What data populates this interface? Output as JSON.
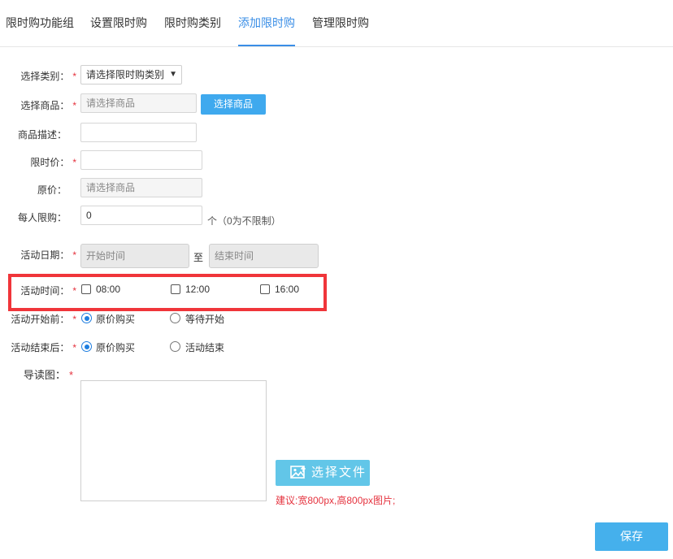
{
  "tabs": [
    {
      "label": "限时购功能组"
    },
    {
      "label": "设置限时购"
    },
    {
      "label": "限时购类别"
    },
    {
      "label": "添加限时购",
      "active": true
    },
    {
      "label": "管理限时购"
    }
  ],
  "form": {
    "category": {
      "label": "选择类别：",
      "required": "*",
      "value": "请选择限时购类别"
    },
    "product": {
      "label": "选择商品：",
      "required": "*",
      "placeholder": "请选择商品",
      "button": "选择商品"
    },
    "description": {
      "label": "商品描述：",
      "value": ""
    },
    "flash_price": {
      "label": "限时价：",
      "required": "*",
      "value": ""
    },
    "original_price": {
      "label": "原价：",
      "placeholder": "请选择商品"
    },
    "limit_per_person": {
      "label": "每人限购：",
      "value": "0",
      "note": "个（0为不限制）"
    },
    "activity_date": {
      "label": "活动日期：",
      "required": "*",
      "start_placeholder": "开始时间",
      "to": "至",
      "end_placeholder": "结束时间"
    },
    "activity_time": {
      "label": "活动时间：",
      "required": "*",
      "options": [
        {
          "label": "08:00",
          "checked": false
        },
        {
          "label": "12:00",
          "checked": false
        },
        {
          "label": "16:00",
          "checked": false
        }
      ]
    },
    "before_start": {
      "label": "活动开始前：",
      "required": "*",
      "options": [
        {
          "label": "原价购买",
          "selected": true
        },
        {
          "label": "等待开始",
          "selected": false
        }
      ]
    },
    "after_end": {
      "label": "活动结束后：",
      "required": "*",
      "options": [
        {
          "label": "原价购买",
          "selected": true
        },
        {
          "label": "活动结束",
          "selected": false
        }
      ]
    },
    "guide_image": {
      "label": "导读图：",
      "required": "*",
      "button": "选择文件",
      "hint": "建议:宽800px,高800px图片;"
    }
  },
  "actions": {
    "save": "保存"
  },
  "colors": {
    "accent": "#3a8ee6",
    "required": "#e5323e",
    "highlight": "#f0353a",
    "button": "#45b0ec"
  }
}
